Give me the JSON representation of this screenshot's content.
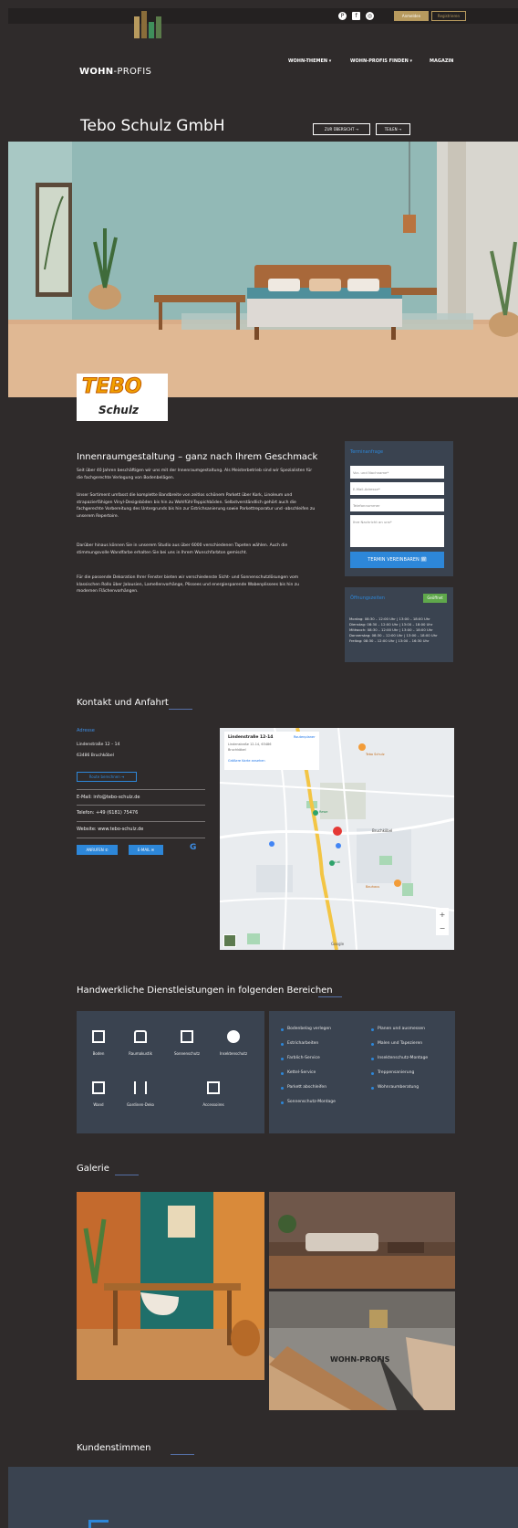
{
  "topbar": {
    "social_icons": [
      "pinterest-icon",
      "facebook-icon",
      "instagram-icon"
    ],
    "login_label": "Anmelden",
    "register_label": "Registrieren"
  },
  "brand": {
    "name_bold": "WOHN",
    "name_rest": "-PROFIS",
    "accent": "#b79a5e"
  },
  "nav": [
    {
      "label": "WOHN-THEMEN ▾"
    },
    {
      "label": "WOHN-PROFIS FINDEN ▾"
    },
    {
      "label": "MAGAZIN"
    }
  ],
  "page": {
    "title": "Tebo Schulz GmbH",
    "overview_button": "ZUR ÜBERSICHT →",
    "share_button": "TEILEN →",
    "company_logo_top": "TEBO",
    "company_logo_bottom": "Schulz"
  },
  "intro": {
    "heading": "Innenraumgestaltung – ganz nach Ihrem Geschmack",
    "paragraphs": [
      "Seit über 40 Jahren beschäftigen wir uns mit der Innenraumgestaltung. Als Meisterbetrieb sind wir Spezialisten für die fachgerechte Verlegung von Bodenbelägen.",
      "Unser Sortiment umfasst die komplette Bandbreite von zeitlos schönem Parkett über Kork, Linoleum und strapazierfähigen Vinyl-Designböden bis hin zu Wohlfühl-Teppichböden. Selbstverständlich gehört auch die fachgerechte Vorbereitung des Untergrunds bis hin zur Estrichsanierung sowie Parkettreparatur und -abschleifen zu unserem Repertoire.",
      "Darüber hinaus können Sie in unserem Studio aus über 6000 verschiedenen Tapeten wählen. Auch die stimmungsvolle Wandfarbe erhalten Sie bei uns in Ihrem Wunschfarbton gemischt.",
      "Für die passende Dekoration Ihrer Fenster bieten wir verschiedenste Sicht- und Sonnenschutzlösungen vom klassischen Rollo über Jalousien, Lamellenvorhänge, Plissees und energiesparende Wabenplissees bis hin zu modernen Flächenvorhängen."
    ]
  },
  "appointment": {
    "title": "Terminanfrage",
    "fields": [
      "Vor- und Nachname*",
      "E-Mail-Adresse*",
      "Telefonnummer",
      "Ihre Nachricht an uns*"
    ],
    "submit": "TERMIN VEREINBAREN 🗓"
  },
  "hours": {
    "title": "Öffnungszeiten",
    "status": "Geöffnet",
    "lines": [
      "Montag: 08:30 – 12:00 Uhr | 13:00 – 18:00 Uhr",
      "Dienstag: 08:30 – 12:00 Uhr | 13:00 – 18:00 Uhr",
      "Mittwoch: 08:30 – 12:00 Uhr | 13:00 – 18:00 Uhr",
      "Donnerstag: 08:30 – 12:00 Uhr | 13:00 – 18:00 Uhr",
      "Freitag: 08:30 – 12:00 Uhr | 13:00 – 16:30 Uhr"
    ]
  },
  "contact": {
    "heading": "Kontakt und Anfahrt",
    "label": "Adresse",
    "street": "Lindenstraße 12 – 14",
    "city": "63486 Bruchköbel",
    "route_button": "Route berechnen ➜",
    "email": "E-Mail: info@tebo-schulz.de",
    "phone": "Telefon: +49 (6181) 75476",
    "website": "Website: www.tebo-schulz.de",
    "btn_phone": "ANRUFEN ✆",
    "btn_mail": "E-MAIL ✉",
    "google_icon": "G"
  },
  "map": {
    "card_title": "Lindenstraße 12-14",
    "card_line1": "Lindenstraße 12-14, 63486",
    "card_line2": "Bruchköbel",
    "card_link": "Größere Karte ansehen",
    "route_label": "Routenplaner",
    "town_label": "Bruchköbel",
    "place_label_1": "Tebo Schulz",
    "place_label_2": "Rewe",
    "place_label_3": "Lidl",
    "place_label_4": "Bauhaus",
    "zoom_in": "+",
    "zoom_out": "−",
    "attribution": "Google"
  },
  "services": {
    "heading": "Handwerkliche Dienstleistungen in folgenden Bereichen",
    "icons": [
      {
        "label": "Boden",
        "icon": "floor-icon"
      },
      {
        "label": "Raumakustik",
        "icon": "acoustic-icon"
      },
      {
        "label": "Sonnenschutz",
        "icon": "sunshade-icon"
      },
      {
        "label": "Insektenschutz",
        "icon": "insect-icon"
      },
      {
        "label": "Wand",
        "icon": "wall-icon"
      },
      {
        "label": "Gardinen-Deko",
        "icon": "curtain-icon"
      },
      {
        "label": "Accessoires",
        "icon": "accessories-icon"
      }
    ],
    "list_left": [
      "Bodenbelag verlegen",
      "Estricharbeiten",
      "Farblich-Service",
      "Kettel-Service",
      "Parkett abschleifen",
      "Sonnenschutz-Montage"
    ],
    "list_right": [
      "Planen und ausmessen",
      "Malen und Tapezieren",
      "Insektenschutz-Montage",
      "Treppensanierung",
      "Wohnraumberatung"
    ]
  },
  "gallery": {
    "heading": "Galerie",
    "watermark": "WOHN-PROFIS"
  },
  "testimonials": {
    "heading": "Kundenstimmen"
  },
  "colors": {
    "background": "#2f2b2b",
    "panel": "#3a4350",
    "accent_blue": "#2d87d9",
    "gold": "#b79a5e"
  }
}
